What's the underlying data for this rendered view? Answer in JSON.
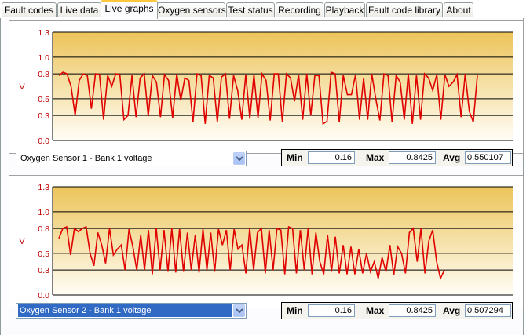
{
  "tabs": [
    {
      "label": "Fault codes",
      "active": false
    },
    {
      "label": "Live data",
      "active": false
    },
    {
      "label": "Live graphs",
      "active": true
    },
    {
      "label": "Oxygen sensors",
      "active": false
    },
    {
      "label": "Test status",
      "active": false
    },
    {
      "label": "Recording",
      "active": false
    },
    {
      "label": "Playback",
      "active": false
    },
    {
      "label": "Fault code library",
      "active": false
    },
    {
      "label": "About",
      "active": false
    }
  ],
  "colors": {
    "line": "#e00000",
    "grid": "#000000",
    "band_top": "#ecc45a",
    "band_bottom": "#fffdf6",
    "tab_highlight": "#ffc83c",
    "axis_text": "#c00000"
  },
  "graphs": [
    {
      "sensor": "Oxygen Sensor 1 - Bank 1 voltage",
      "selected": false,
      "min_label": "Min",
      "min": "0.16",
      "max_label": "Max",
      "max": "0.8425",
      "avg_label": "Avg",
      "avg": "0.550107",
      "chart_data": {
        "type": "line",
        "ylabel": "V",
        "yticks": [
          "1.3",
          "1.0",
          "0.8",
          "0.5",
          "0.3",
          "0.0"
        ],
        "ylim": [
          0,
          1.3
        ],
        "grid": true,
        "series": [
          {
            "values": [
              0.78,
              0.82,
              0.8,
              0.65,
              0.3,
              0.72,
              0.8,
              0.78,
              0.38,
              0.8,
              0.79,
              0.25,
              0.78,
              0.65,
              0.8,
              0.79,
              0.25,
              0.3,
              0.78,
              0.28,
              0.75,
              0.8,
              0.29,
              0.78,
              0.7,
              0.28,
              0.79,
              0.72,
              0.27,
              0.8,
              0.48,
              0.75,
              0.72,
              0.22,
              0.8,
              0.78,
              0.2,
              0.78,
              0.75,
              0.22,
              0.76,
              0.8,
              0.26,
              0.78,
              0.6,
              0.25,
              0.79,
              0.26,
              0.79,
              0.27,
              0.8,
              0.72,
              0.24,
              0.8,
              0.8,
              0.22,
              0.8,
              0.75,
              0.47,
              0.79,
              0.25,
              0.8,
              0.3,
              0.78,
              0.78,
              0.2,
              0.23,
              0.82,
              0.8,
              0.22,
              0.78,
              0.55,
              0.55,
              0.79,
              0.25,
              0.75,
              0.25,
              0.8,
              0.5,
              0.24,
              0.8,
              0.78,
              0.22,
              0.78,
              0.7,
              0.25,
              0.8,
              0.2,
              0.78,
              0.25,
              0.8,
              0.75,
              0.6,
              0.79,
              0.25,
              0.79,
              0.65,
              0.7,
              0.79,
              0.28,
              0.8,
              0.35,
              0.22,
              0.78
            ]
          }
        ]
      }
    },
    {
      "sensor": "Oxygen Sensor 2 - Bank 1 voltage",
      "selected": true,
      "min_label": "Min",
      "min": "0.16",
      "max_label": "Max",
      "max": "0.8425",
      "avg_label": "Avg",
      "avg": "0.507294",
      "chart_data": {
        "type": "line",
        "ylabel": "V",
        "yticks": [
          "1.3",
          "1.0",
          "0.8",
          "0.5",
          "0.3",
          "0.0"
        ],
        "ylim": [
          0,
          1.3
        ],
        "grid": true,
        "series": [
          {
            "values": [
              0.68,
              0.8,
              0.82,
              0.48,
              0.8,
              0.76,
              0.8,
              0.82,
              0.5,
              0.35,
              0.75,
              0.6,
              0.38,
              0.8,
              0.48,
              0.55,
              0.6,
              0.3,
              0.79,
              0.58,
              0.3,
              0.72,
              0.3,
              0.78,
              0.25,
              0.8,
              0.3,
              0.78,
              0.28,
              0.8,
              0.27,
              0.79,
              0.28,
              0.75,
              0.3,
              0.72,
              0.27,
              0.79,
              0.3,
              0.75,
              0.28,
              0.79,
              0.6,
              0.78,
              0.3,
              0.79,
              0.55,
              0.6,
              0.26,
              0.8,
              0.3,
              0.75,
              0.8,
              0.26,
              0.78,
              0.3,
              0.8,
              0.78,
              0.25,
              0.82,
              0.8,
              0.26,
              0.78,
              0.3,
              0.8,
              0.25,
              0.75,
              0.4,
              0.25,
              0.72,
              0.28,
              0.7,
              0.26,
              0.6,
              0.25,
              0.58,
              0.25,
              0.55,
              0.26,
              0.5,
              0.28,
              0.4,
              0.2,
              0.45,
              0.28,
              0.6,
              0.24,
              0.58,
              0.5,
              0.26,
              0.75,
              0.8,
              0.4,
              0.8,
              0.26,
              0.65,
              0.78,
              0.4,
              0.2,
              0.3
            ]
          }
        ]
      }
    }
  ]
}
